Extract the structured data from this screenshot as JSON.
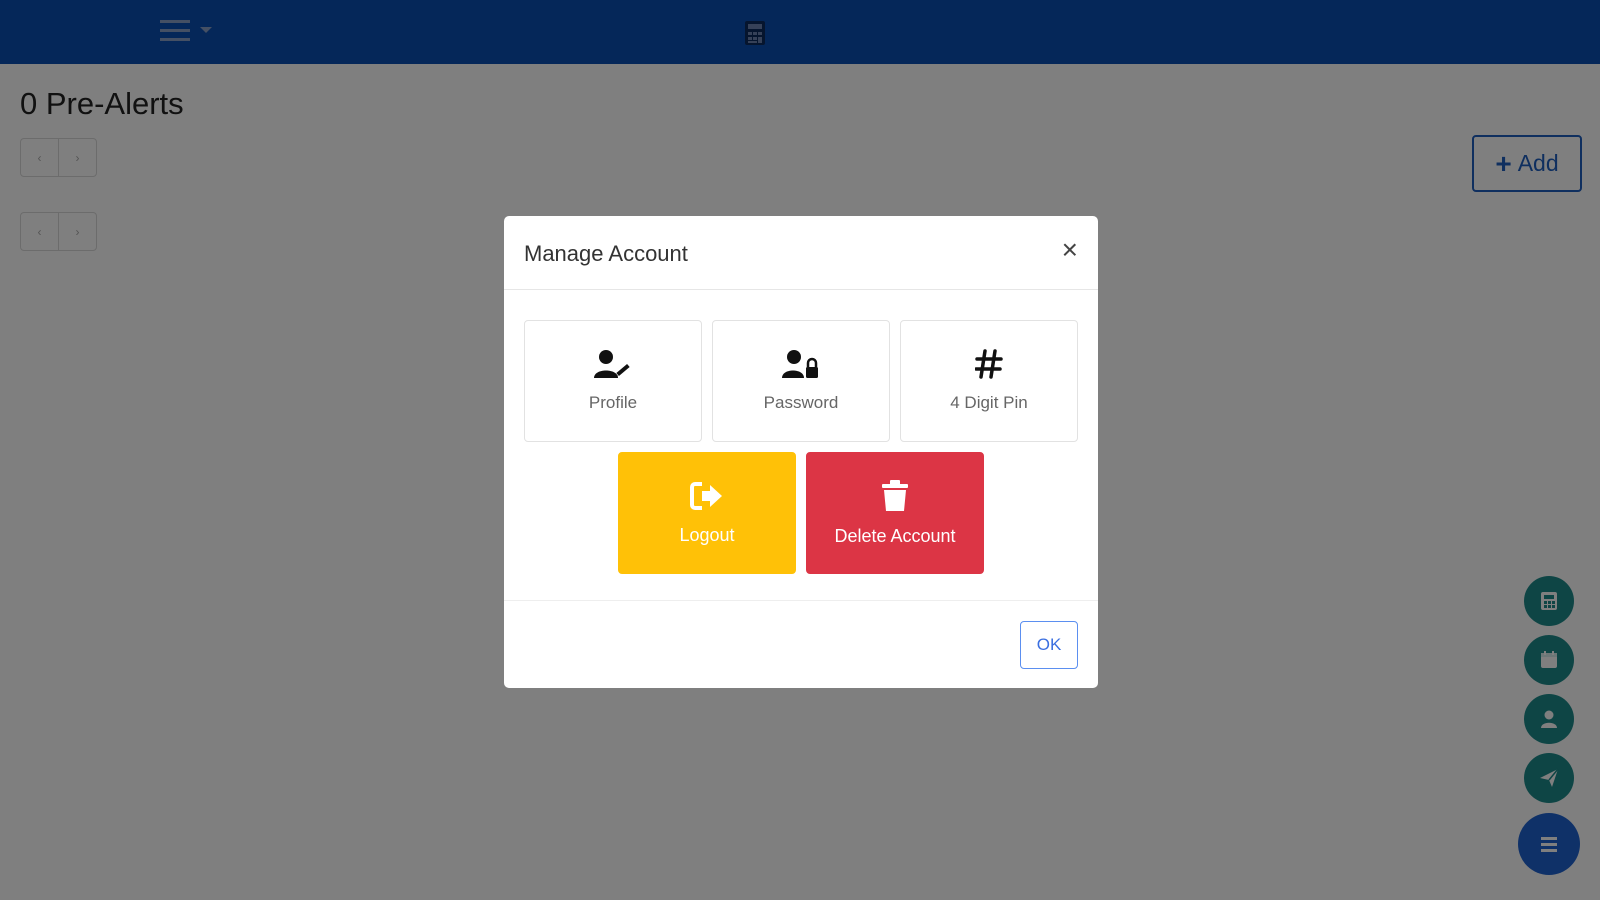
{
  "page": {
    "title": "0 Pre-Alerts",
    "add_label": "Add",
    "pager_prev": "‹",
    "pager_next": "›"
  },
  "navbar": {
    "color": "#0b4fb3",
    "hamburger_icon": "hamburger-icon",
    "logo_icon": "calculator-icon"
  },
  "modal": {
    "title": "Manage Account",
    "close_label": "×",
    "tiles": [
      {
        "label": "Profile",
        "icon": "user-edit-icon"
      },
      {
        "label": "Password",
        "icon": "user-lock-icon"
      },
      {
        "label": "4 Digit Pin",
        "icon": "hashtag-icon"
      }
    ],
    "actions": [
      {
        "label": "Logout",
        "icon": "sign-out-icon",
        "color": "#ffc107"
      },
      {
        "label": "Delete Account",
        "icon": "trash-icon",
        "color": "#dc3545"
      }
    ],
    "ok_label": "OK"
  },
  "fabs": [
    {
      "icon": "calculator-icon"
    },
    {
      "icon": "calendar-icon"
    },
    {
      "icon": "user-icon"
    },
    {
      "icon": "paper-plane-icon"
    },
    {
      "icon": "menu-icon"
    }
  ]
}
